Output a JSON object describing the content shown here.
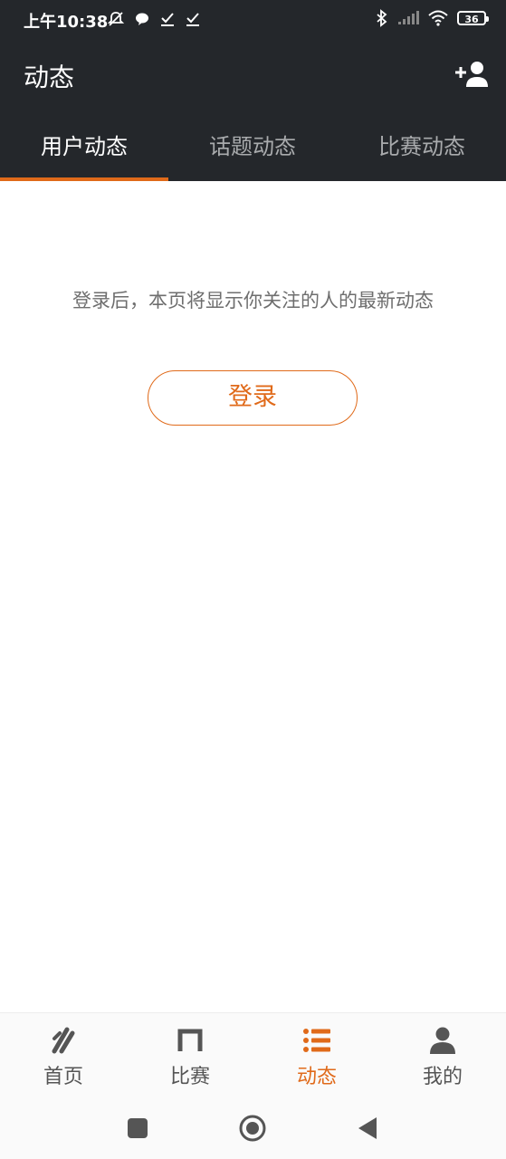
{
  "status_bar": {
    "time": "上午10:38",
    "battery": "36"
  },
  "header": {
    "title": "动态"
  },
  "tabs": [
    {
      "label": "用户动态",
      "active": true
    },
    {
      "label": "话题动态",
      "active": false
    },
    {
      "label": "比赛动态",
      "active": false
    }
  ],
  "empty_state": {
    "message": "登录后，本页将显示你关注的人的最新动态",
    "login_label": "登录"
  },
  "bottom_nav": [
    {
      "label": "首页",
      "icon": "home-icon",
      "active": false
    },
    {
      "label": "比赛",
      "icon": "match-icon",
      "active": false
    },
    {
      "label": "动态",
      "icon": "feed-list-icon",
      "active": true
    },
    {
      "label": "我的",
      "icon": "profile-icon",
      "active": false
    }
  ],
  "colors": {
    "header_bg": "#24272b",
    "accent": "#e06a1a",
    "inactive_tab": "#a9abad"
  }
}
